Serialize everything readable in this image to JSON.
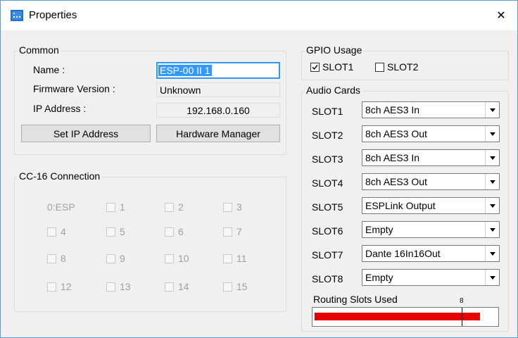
{
  "window": {
    "title": "Properties",
    "close_glyph": "✕"
  },
  "common": {
    "title": "Common",
    "name_label": "Name :",
    "name_value": "ESP-00 II 1",
    "firmware_label": "Firmware Version :",
    "firmware_value": "Unknown",
    "ip_label": "IP Address :",
    "ip_value": "192.168.0.160",
    "set_ip_button": "Set IP Address",
    "hardware_manager_button": "Hardware Manager"
  },
  "cc16": {
    "title": "CC-16 Connection",
    "esp_label": "0:ESP",
    "items": [
      "1",
      "2",
      "3",
      "4",
      "5",
      "6",
      "7",
      "8",
      "9",
      "10",
      "11",
      "12",
      "13",
      "14",
      "15"
    ]
  },
  "gpio": {
    "title": "GPIO Usage",
    "slots": [
      {
        "label": "SLOT1",
        "checked": true
      },
      {
        "label": "SLOT2",
        "checked": false
      }
    ]
  },
  "audio_cards": {
    "title": "Audio Cards",
    "slots": [
      {
        "label": "SLOT1",
        "value": "8ch AES3 In"
      },
      {
        "label": "SLOT2",
        "value": "8ch AES3 Out"
      },
      {
        "label": "SLOT3",
        "value": "8ch AES3 In"
      },
      {
        "label": "SLOT4",
        "value": "8ch AES3 Out"
      },
      {
        "label": "SLOT5",
        "value": "ESPLink Output"
      },
      {
        "label": "SLOT6",
        "value": "Empty"
      },
      {
        "label": "SLOT7",
        "value": "Dante 16In16Out"
      },
      {
        "label": "SLOT8",
        "value": "Empty"
      }
    ]
  },
  "routing": {
    "label": "Routing Slots Used",
    "marker_label": "8",
    "used_fraction": 0.91,
    "marker_fraction": 0.81,
    "bar_color": "#e60000"
  },
  "icons": {
    "app": "app-icon",
    "close": "close-icon",
    "dropdown": "chevron-down-icon",
    "check": "check-icon"
  }
}
